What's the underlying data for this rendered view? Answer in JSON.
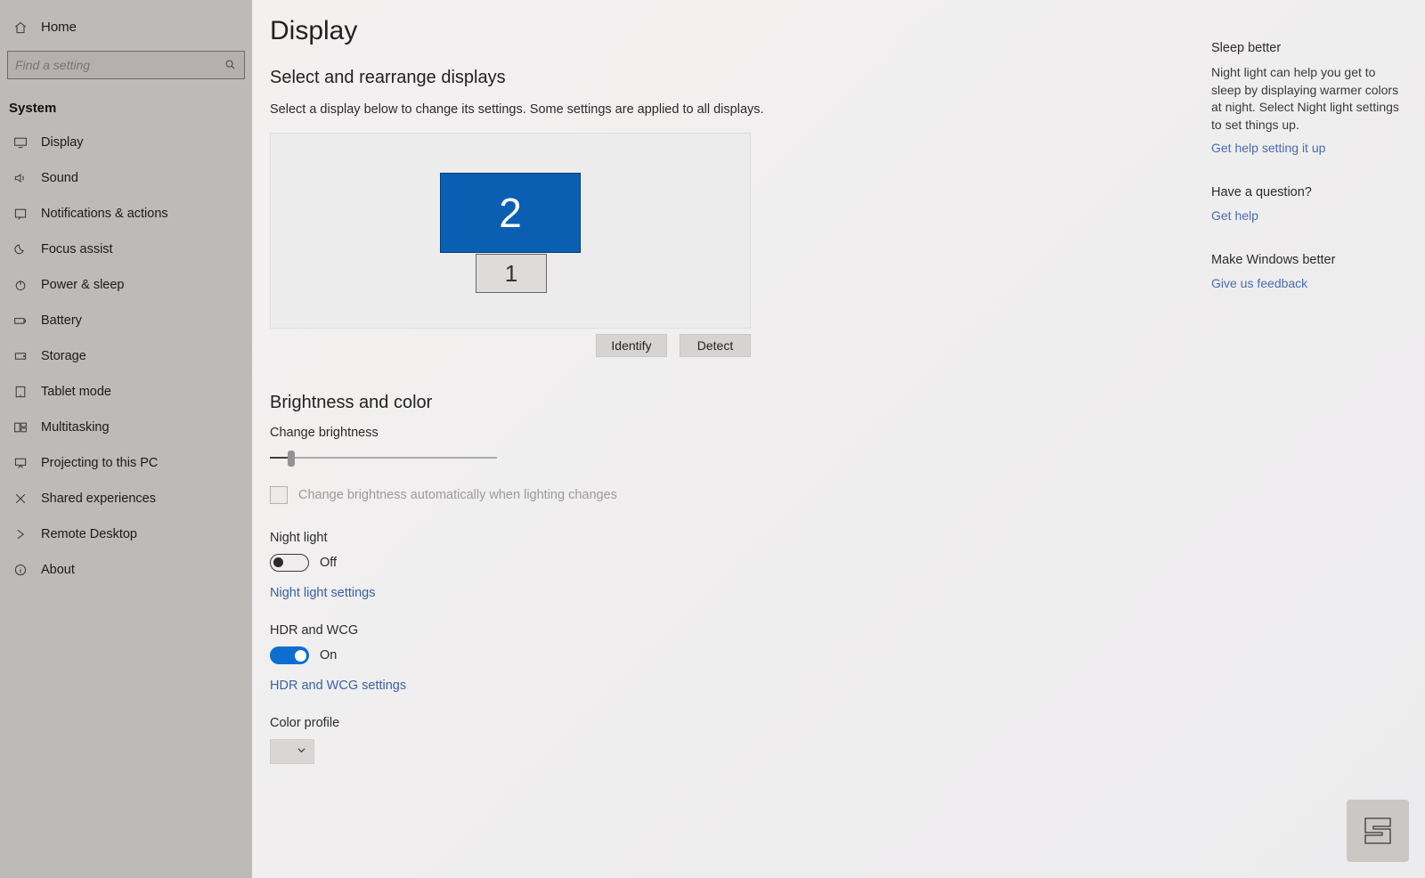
{
  "sidebar": {
    "home": "Home",
    "search_placeholder": "Find a setting",
    "category": "System",
    "items": [
      {
        "label": "Display"
      },
      {
        "label": "Sound"
      },
      {
        "label": "Notifications & actions"
      },
      {
        "label": "Focus assist"
      },
      {
        "label": "Power & sleep"
      },
      {
        "label": "Battery"
      },
      {
        "label": "Storage"
      },
      {
        "label": "Tablet mode"
      },
      {
        "label": "Multitasking"
      },
      {
        "label": "Projecting to this PC"
      },
      {
        "label": "Shared experiences"
      },
      {
        "label": "Remote Desktop"
      },
      {
        "label": "About"
      }
    ]
  },
  "page": {
    "title": "Display",
    "arrange": {
      "heading": "Select and rearrange displays",
      "desc": "Select a display below to change its settings. Some settings are applied to all displays.",
      "monitor2": "2",
      "monitor1": "1",
      "identify": "Identify",
      "detect": "Detect"
    },
    "brightness": {
      "heading": "Brightness and color",
      "change_label": "Change brightness",
      "auto_label": "Change brightness automatically when lighting changes",
      "night_label": "Night light",
      "night_state": "Off",
      "night_link": "Night light settings",
      "hdr_label": "HDR and WCG",
      "hdr_state": "On",
      "hdr_link": "HDR and WCG settings",
      "color_profile": "Color profile"
    }
  },
  "tips": {
    "t1_title": "Sleep better",
    "t1_body": "Night light can help you get to sleep by displaying warmer colors at night. Select Night light settings to set things up.",
    "t1_link": "Get help setting it up",
    "t2_title": "Have a question?",
    "t2_link": "Get help",
    "t3_title": "Make Windows better",
    "t3_link": "Give us feedback"
  }
}
